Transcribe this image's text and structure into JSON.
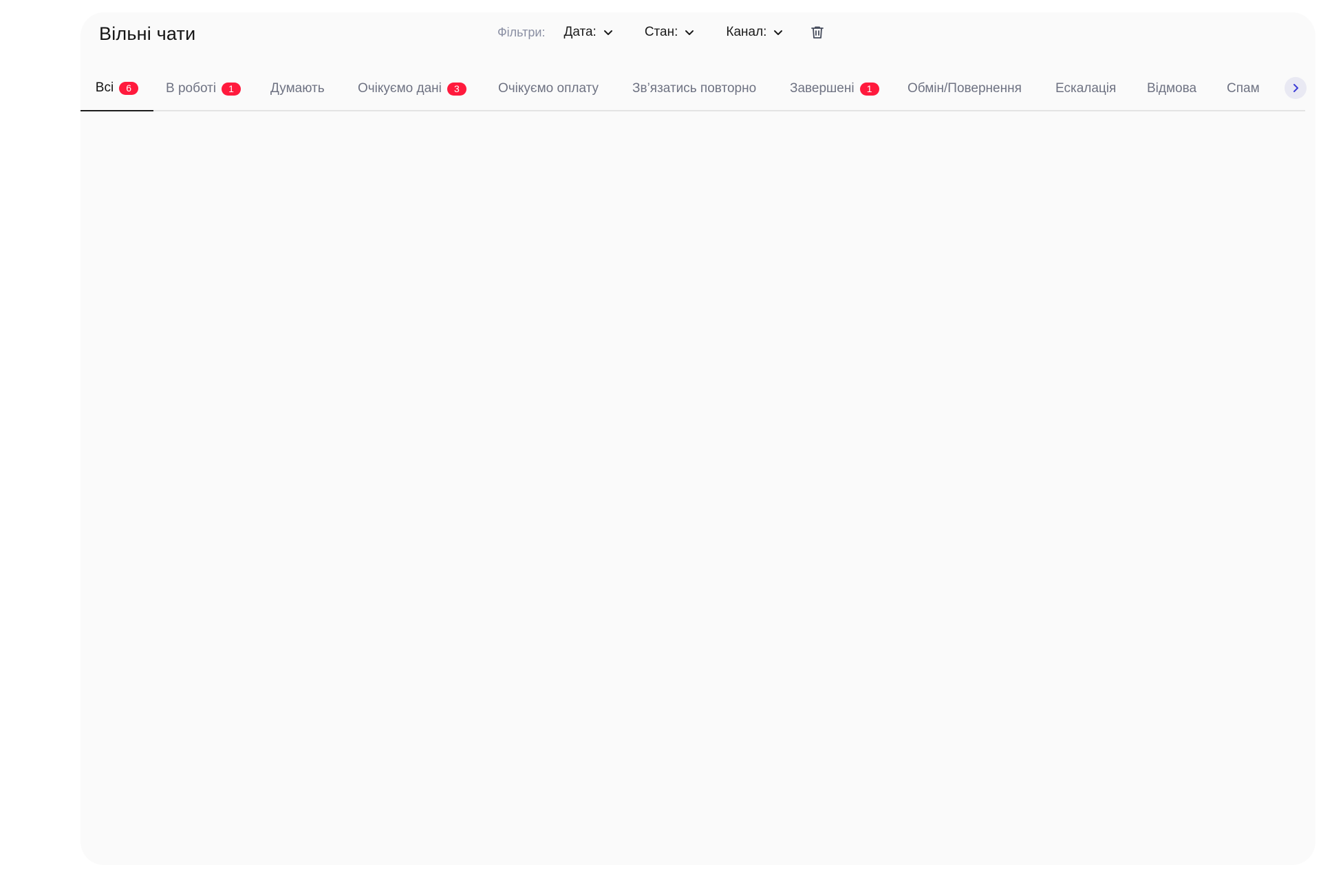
{
  "header": {
    "title": "Вільні чати"
  },
  "filters": {
    "label": "Фільтри:",
    "items": [
      {
        "label": "Дата:"
      },
      {
        "label": "Стан:"
      },
      {
        "label": "Канал:"
      }
    ],
    "clear_icon": "trash-icon"
  },
  "tabs": [
    {
      "label": "Всі",
      "badge": "6",
      "active": true
    },
    {
      "label": "В роботі",
      "badge": "1"
    },
    {
      "label": "Думають",
      "badge": null
    },
    {
      "label": "Очікуємо дані",
      "badge": "3"
    },
    {
      "label": "Очікуємо оплату",
      "badge": null
    },
    {
      "label": "Зв’язатись повторно",
      "badge": null
    },
    {
      "label": "Завершені",
      "badge": "1"
    },
    {
      "label": "Обмін/Повернення",
      "badge": null
    },
    {
      "label": "Ескалація",
      "badge": null
    },
    {
      "label": "Відмова",
      "badge": null
    },
    {
      "label": "Спам",
      "badge": null
    }
  ],
  "tabs_next_icon": "chevron-right-icon",
  "colors": {
    "badge": "#ff1a3d",
    "accent_arrow": "#3d3dd6",
    "panel_bg": "#fafafa"
  }
}
